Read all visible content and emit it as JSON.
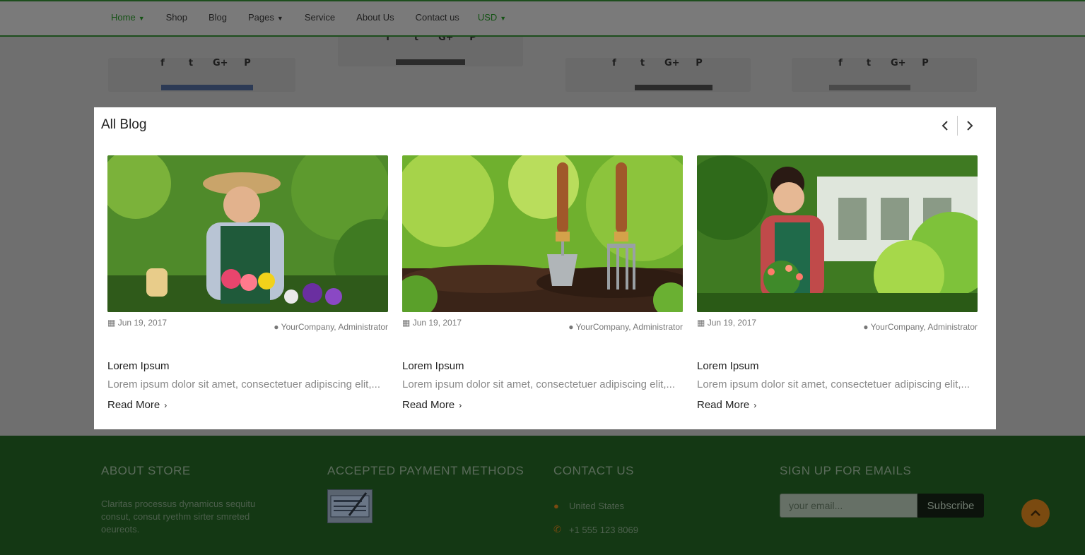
{
  "nav": {
    "items": [
      {
        "label": "Home",
        "dropdown": true,
        "active": true
      },
      {
        "label": "Shop",
        "dropdown": false
      },
      {
        "label": "Blog",
        "dropdown": false
      },
      {
        "label": "Pages",
        "dropdown": true
      },
      {
        "label": "Service",
        "dropdown": false
      },
      {
        "label": "About Us",
        "dropdown": false
      },
      {
        "label": "Contact us",
        "dropdown": false
      },
      {
        "label": "USD",
        "dropdown": true,
        "active": true
      }
    ]
  },
  "modal": {
    "title": "All Blog",
    "posts": [
      {
        "date": "Jun 19, 2017",
        "author": "YourCompany, Administrator",
        "title": "Lorem Ipsum",
        "excerpt": "Lorem ipsum dolor sit amet, consectetuer adipiscing elit,...",
        "read_more": "Read More"
      },
      {
        "date": "Jun 19, 2017",
        "author": "YourCompany, Administrator",
        "title": "Lorem Ipsum",
        "excerpt": "Lorem ipsum dolor sit amet, consectetuer adipiscing elit,...",
        "read_more": "Read More"
      },
      {
        "date": "Jun 19, 2017",
        "author": "YourCompany, Administrator",
        "title": "Lorem Ipsum",
        "excerpt": "Lorem ipsum dolor sit amet, consectetuer adipiscing elit,...",
        "read_more": "Read More"
      }
    ]
  },
  "footer": {
    "about": {
      "heading": "ABOUT STORE",
      "text": "Claritas processus dynamicus sequitu consut, consut ryethm sirter smreted oeureots."
    },
    "payment": {
      "heading": "ACCEPTED PAYMENT METHODS"
    },
    "contact": {
      "heading": "CONTACT US",
      "location": "United States",
      "phone": "+1 555 123 8069"
    },
    "signup": {
      "heading": "SIGN UP FOR EMAILS",
      "placeholder": "your email...",
      "button": "Subscribe"
    }
  },
  "colors": {
    "nav_active": "#145214",
    "footer_bg": "#143814",
    "accent": "#7a4a10"
  }
}
